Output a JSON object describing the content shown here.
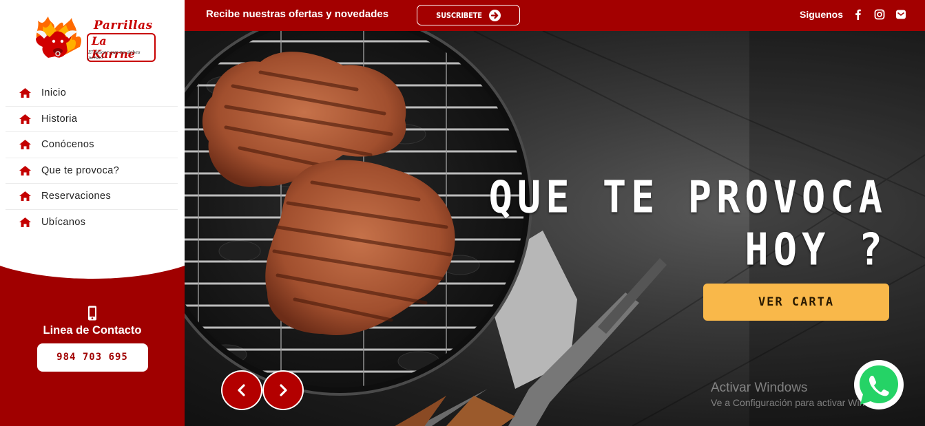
{
  "brand": {
    "name_line1": "Parrillas",
    "name_line2": "La Karrne",
    "tagline": "El placer que no debes perder",
    "color_primary": "#a30000",
    "color_accent": "#f9b84a"
  },
  "sidebar": {
    "items": [
      {
        "label": "Inicio",
        "icon": "home-icon"
      },
      {
        "label": "Historia",
        "icon": "home-icon"
      },
      {
        "label": "Conócenos",
        "icon": "home-icon"
      },
      {
        "label": "Que te provoca?",
        "icon": "home-icon"
      },
      {
        "label": "Reservaciones",
        "icon": "home-icon"
      },
      {
        "label": "Ubícanos",
        "icon": "home-icon"
      }
    ],
    "contact": {
      "icon": "mobile-phone-icon",
      "title": "Linea de Contacto",
      "number": "984 703 695"
    }
  },
  "topbar": {
    "promo_text": "Recibe nuestras ofertas y novedades",
    "subscribe_label": "SUSCRIBETE",
    "follow_label": "Siguenos",
    "social_icons": [
      "facebook-icon",
      "instagram-icon",
      "email-icon"
    ]
  },
  "hero": {
    "title_line1": "QUE TE PROVOCA",
    "title_line2": "HOY ?",
    "cta_label": "VER CARTA",
    "prev_icon": "chevron-left-icon",
    "next_icon": "chevron-right-icon"
  },
  "watermark": {
    "line1": "Activar Windows",
    "line2": "Ve a Configuración para activar Windows."
  },
  "floating": {
    "icon": "whatsapp-icon"
  }
}
